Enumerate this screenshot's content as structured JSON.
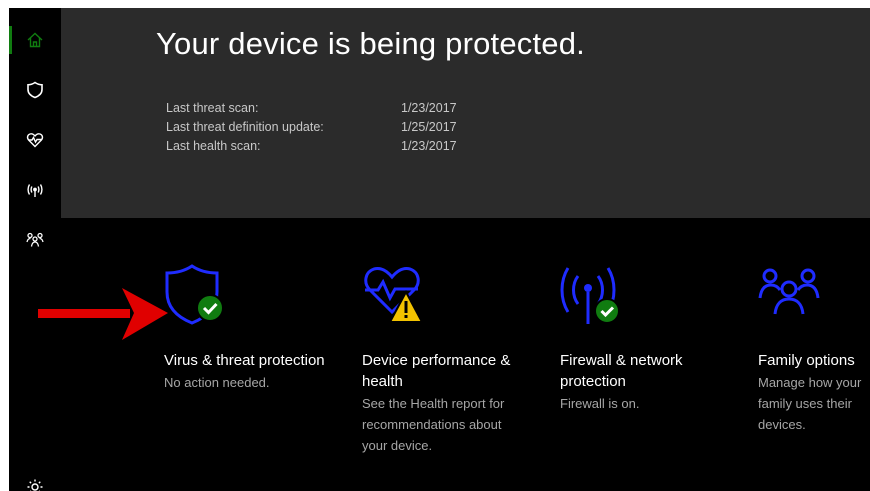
{
  "colors": {
    "accent_blue": "#1f2cff",
    "status_green": "#107c10",
    "warning_yellow": "#f2c200",
    "hero_bg": "#2b2b2b",
    "arrow_red": "#e00000"
  },
  "sidebar": {
    "items": [
      {
        "icon": "home-icon",
        "active": true
      },
      {
        "icon": "shield-icon",
        "active": false
      },
      {
        "icon": "heart-icon",
        "active": false
      },
      {
        "icon": "wireless-icon",
        "active": false
      },
      {
        "icon": "family-icon",
        "active": false
      },
      {
        "icon": "gear-icon",
        "active": false
      }
    ]
  },
  "hero": {
    "title": "Your device is being protected.",
    "status": [
      {
        "label": "Last threat scan:",
        "value": "1/23/2017"
      },
      {
        "label": "Last threat definition update:",
        "value": "1/25/2017"
      },
      {
        "label": "Last health scan:",
        "value": "1/23/2017"
      }
    ]
  },
  "tiles": [
    {
      "icon": "virus-shield-check-icon",
      "title": "Virus & threat protection",
      "description": "No action needed."
    },
    {
      "icon": "device-health-warning-icon",
      "title": "Device performance & health",
      "description": "See the Health report for recommendations about your device."
    },
    {
      "icon": "firewall-check-icon",
      "title": "Firewall & network protection",
      "description": "Firewall is on."
    },
    {
      "icon": "family-options-icon",
      "title": "Family options",
      "description": "Manage how your family uses their devices."
    }
  ]
}
